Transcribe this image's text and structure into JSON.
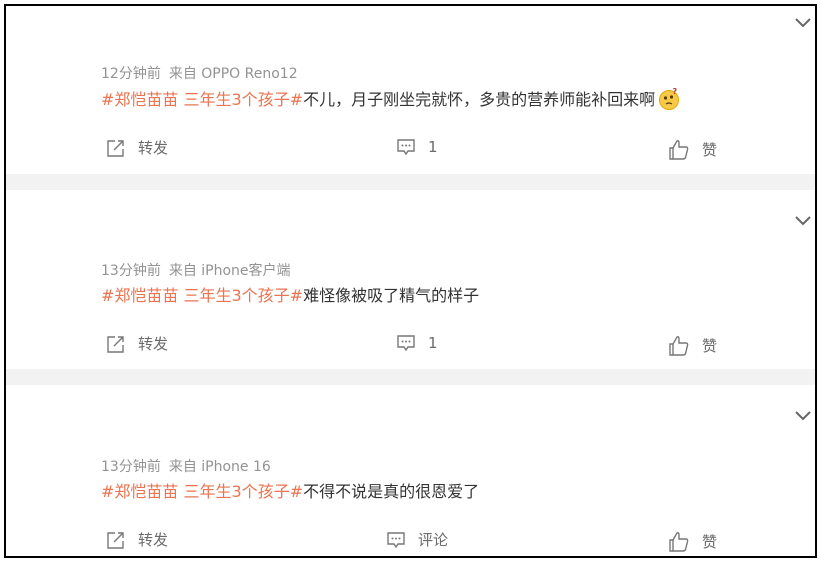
{
  "actions": {
    "repost_label": "转发",
    "like_label": "赞"
  },
  "posts": [
    {
      "time": "12分钟前",
      "source": "来自 OPPO Reno12",
      "hashtag": "#郑恺苗苗 三年生3个孩子#",
      "text": "不儿，月子刚坐完就怀，多贵的营养师能补回来啊",
      "emoji": "thinking-face-icon",
      "comment_value": "1"
    },
    {
      "time": "13分钟前",
      "source": "来自 iPhone客户端",
      "hashtag": "#郑恺苗苗 三年生3个孩子#",
      "text": "难怪像被吸了精气的样子",
      "comment_value": "1"
    },
    {
      "time": "13分钟前",
      "source": "来自 iPhone 16",
      "hashtag": "#郑恺苗苗 三年生3个孩子#",
      "text": "不得不说是真的很恩爱了",
      "comment_value": "评论"
    }
  ],
  "colors": {
    "hashtag": "#eb7350",
    "separator": "#f2f2f2",
    "meta": "#939393"
  }
}
